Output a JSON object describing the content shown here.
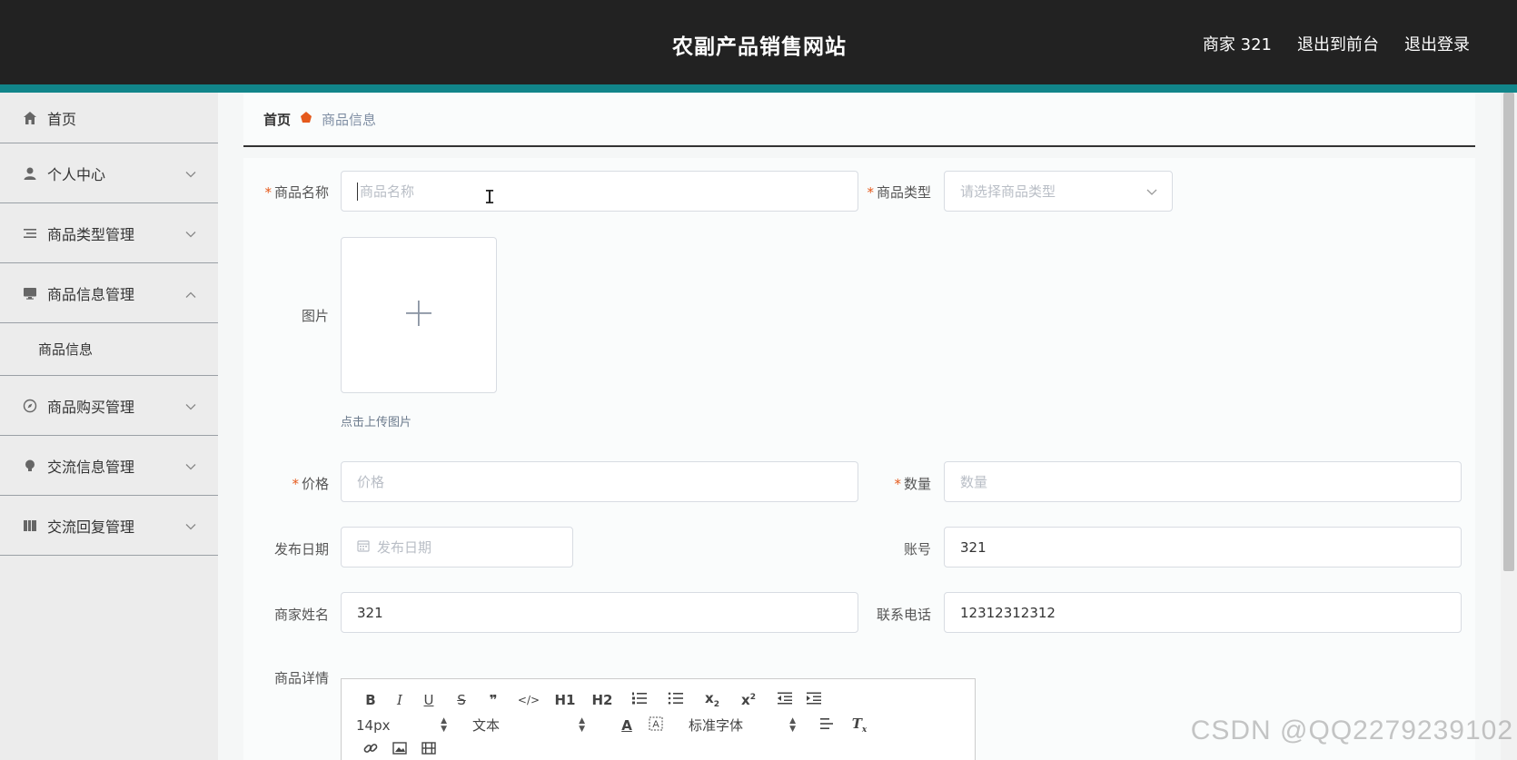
{
  "header": {
    "title": "农副产品销售网站",
    "user_label": "商家 321",
    "to_front_label": "退出到前台",
    "logout_label": "退出登录"
  },
  "sidebar": {
    "items": [
      {
        "label": "首页",
        "icon": "home-icon"
      },
      {
        "label": "个人中心",
        "icon": "user-icon",
        "expanded": false
      },
      {
        "label": "商品类型管理",
        "icon": "list-icon",
        "expanded": false
      },
      {
        "label": "商品信息管理",
        "icon": "monitor-icon",
        "expanded": true,
        "children": [
          "商品信息"
        ]
      },
      {
        "label": "商品购买管理",
        "icon": "compass-icon",
        "expanded": false
      },
      {
        "label": "交流信息管理",
        "icon": "bulb-icon",
        "expanded": false
      },
      {
        "label": "交流回复管理",
        "icon": "book-icon",
        "expanded": false
      }
    ]
  },
  "breadcrumb": {
    "home": "首页",
    "current": "商品信息"
  },
  "form": {
    "name": {
      "label": "商品名称",
      "placeholder": "商品名称",
      "value": ""
    },
    "type": {
      "label": "商品类型",
      "placeholder": "请选择商品类型"
    },
    "image": {
      "label": "图片",
      "hint": "点击上传图片"
    },
    "price": {
      "label": "价格",
      "placeholder": "价格"
    },
    "quantity": {
      "label": "数量",
      "placeholder": "数量"
    },
    "publish_date": {
      "label": "发布日期",
      "placeholder": "发布日期"
    },
    "account": {
      "label": "账号",
      "value": "321"
    },
    "merchant_name": {
      "label": "商家姓名",
      "value": "321"
    },
    "phone": {
      "label": "联系电话",
      "value": "12312312312"
    },
    "details": {
      "label": "商品详情"
    }
  },
  "editor": {
    "font_size": "14px",
    "block_format": "文本",
    "font_family": "标准字体",
    "buttons_row1": [
      "B",
      "I",
      "U",
      "S",
      "❞",
      "</>",
      "H1",
      "H2",
      "ordered-list",
      "bullet-list",
      "sub",
      "sup",
      "outdent",
      "indent"
    ],
    "buttons_row3": [
      "link-icon",
      "image-icon",
      "video-icon"
    ]
  },
  "watermark": "CSDN @QQ2279239102",
  "colors": {
    "topbar": "#222222",
    "accent": "#11858a",
    "required": "#e55a1c",
    "sidebar_bg": "#ececec"
  }
}
